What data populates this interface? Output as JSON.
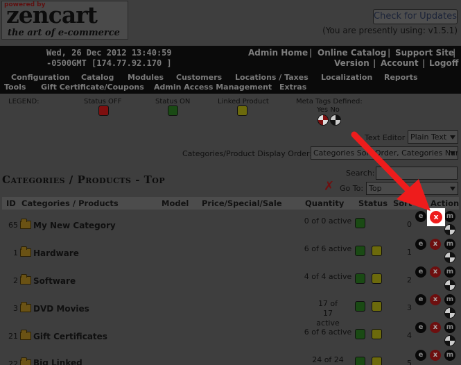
{
  "header": {
    "powered_by": "powered by",
    "brand": "zencart",
    "tagline": "the art of e-commerce",
    "check_updates_label": "Check for Updates",
    "version_text": "(You are presently using: v1.5.1)"
  },
  "topbar": {
    "datetime_line1": "Wed, 26 Dec 2012 13:40:59",
    "datetime_line2": "-0500GMT [174.77.92.170 ]",
    "links": {
      "admin_home": "Admin Home",
      "online_catalog": "Online Catalog",
      "support_site": "Support Site",
      "version": "Version",
      "account": "Account",
      "logoff": "Logoff"
    },
    "separator": "|"
  },
  "menu": {
    "configuration": "Configuration",
    "catalog": "Catalog",
    "modules": "Modules",
    "customers": "Customers",
    "locations_taxes": "Locations / Taxes",
    "localization": "Localization",
    "reports": "Reports",
    "tools": "Tools",
    "gift_certificate": "Gift Certificate/Coupons",
    "admin_access": "Admin Access Management",
    "extras": "Extras"
  },
  "legend": {
    "label": "LEGEND:",
    "status_off": "Status OFF",
    "status_on": "Status ON",
    "linked_product": "Linked Product",
    "meta_tags": "Meta Tags Defined:",
    "meta_yes_no": "Yes No"
  },
  "controls": {
    "text_editor_label": "Text Editor",
    "text_editor_value": "Plain Text",
    "display_order_label": "Categories/Product Display Order:",
    "display_order_value": "Categories Sort Order, Categories Name",
    "search_label": "Search:",
    "search_value": "",
    "goto_label": "Go To:",
    "goto_value": "Top"
  },
  "page_title": "Categories / Products - Top",
  "table": {
    "headers": {
      "id": "ID",
      "categories_products": "Categories / Products",
      "model": "Model",
      "price": "Price/Special/Sale",
      "quantity": "Quantity",
      "status": "Status",
      "sort": "Sort",
      "action": "Action"
    },
    "rows": [
      {
        "id": "65",
        "name": "My New Category",
        "qty": "0 of 0 active",
        "linked": false,
        "sort": "0"
      },
      {
        "id": "1",
        "name": "Hardware",
        "qty": "6 of 6 active",
        "linked": true,
        "sort": "1"
      },
      {
        "id": "2",
        "name": "Software",
        "qty": "4 of 4 active",
        "linked": true,
        "sort": "2"
      },
      {
        "id": "3",
        "name": "DVD Movies",
        "qty": "17 of 17 active",
        "linked": true,
        "sort": "3"
      },
      {
        "id": "21",
        "name": "Gift Certificates",
        "qty": "6 of 6 active",
        "linked": true,
        "sort": "4"
      },
      {
        "id": "22",
        "name": "Big Linked",
        "qty": "24 of 24",
        "linked": true,
        "sort": "5"
      }
    ],
    "action_labels": {
      "edit": "e",
      "delete": "x",
      "move": "m"
    }
  },
  "colors": {
    "annotation_arrow": "#ee1c1c",
    "status_off": "#7e0f0f",
    "status_on": "#1a4a14",
    "linked": "#6c6a0c"
  }
}
